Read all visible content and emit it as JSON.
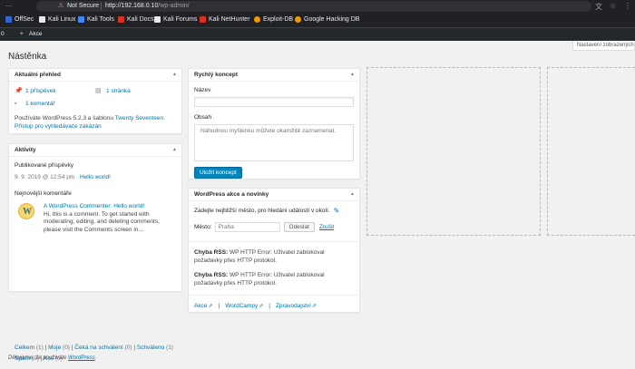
{
  "browser": {
    "security_label": "Not Secure",
    "url_host": "http://192.168.0.10",
    "url_path": "/wp-admin/",
    "bookmarks": [
      {
        "label": "OffSec",
        "color": "#3367d6"
      },
      {
        "label": "Kali Linux",
        "color": "#e8eaed"
      },
      {
        "label": "Kali Tools",
        "color": "#e8eaed"
      },
      {
        "label": "Kali Docs",
        "color": "#d93025"
      },
      {
        "label": "Kali Forums",
        "color": "#e8eaed"
      },
      {
        "label": "Kali NetHunter",
        "color": "#d93025"
      },
      {
        "label": "Exploit-DB",
        "color": "#f29900"
      },
      {
        "label": "Google Hacking DB",
        "color": "#f29900"
      }
    ]
  },
  "adminbar": {
    "comments_count": "0",
    "new_label": "Akce"
  },
  "screen_options_label": "Nastavení zobrazených",
  "page_title": "Nástěnka",
  "at_a_glance": {
    "title": "Aktuální přehled",
    "posts": "1 příspěvek",
    "pages": "1 stránka",
    "comments": "1 komentář",
    "version_text_pre": "Používáte WordPress 5.2.3 a šablonu ",
    "theme_link": "Twenty Seventeen",
    "version_text_post": ".",
    "search_engines": "Přístup pro vyhledávače zakázán"
  },
  "activity": {
    "title": "Aktivity",
    "published_heading": "Publikované příspěvky",
    "post_date": "9. 9. 2019 @ 12:54 pm",
    "post_title": "Hello world!",
    "comments_heading": "Nejnovější komentáře",
    "comment_author_pre": "A WordPress Commenter: ",
    "comment_post": "Hello world!",
    "comment_text": "Hi, this is a comment. To get started with moderating, editing, and deleting comments, please visit the Comments screen in…",
    "filters": {
      "all": "Celkem",
      "all_count": "(1)",
      "mine": "Moje",
      "mine_count": "(0)",
      "pending": "Čeká na schválení",
      "pending_count": "(0)",
      "approved": "Schváleno",
      "approved_count": "(1)",
      "spam": "Spam",
      "spam_count": "(0)",
      "trash": "Koš",
      "trash_count": "(0)"
    }
  },
  "quick_draft": {
    "title": "Rychlý koncept",
    "title_label": "Název",
    "content_label": "Obsah",
    "content_placeholder": "Náhodnou myšlenku můžete okamžitě zaznamenat.",
    "save_button": "Uložit koncept"
  },
  "events": {
    "title": "WordPress akce a novinky",
    "intro": "Zadejte nejbližší město, pro hledání událostí v okolí.",
    "city_label": "Město:",
    "city_placeholder": "Praha",
    "submit": "Odeslat",
    "cancel": "Zrušit",
    "rss_label": "Chyba RSS:",
    "rss_error": " WP HTTP Error: Uživatel zablokoval požadavky přes HTTP protokol.",
    "rss_error2": " WP HTTP Error: Uživatel zablokoval požadavky přes HTTP protokol.",
    "links": {
      "meetups": "Akce",
      "wordcamps": "WordCampy",
      "news": "Zpravodajství"
    }
  },
  "footer": {
    "text": "Děkujeme, že používáte ",
    "link": "WordPress",
    "end": "."
  }
}
